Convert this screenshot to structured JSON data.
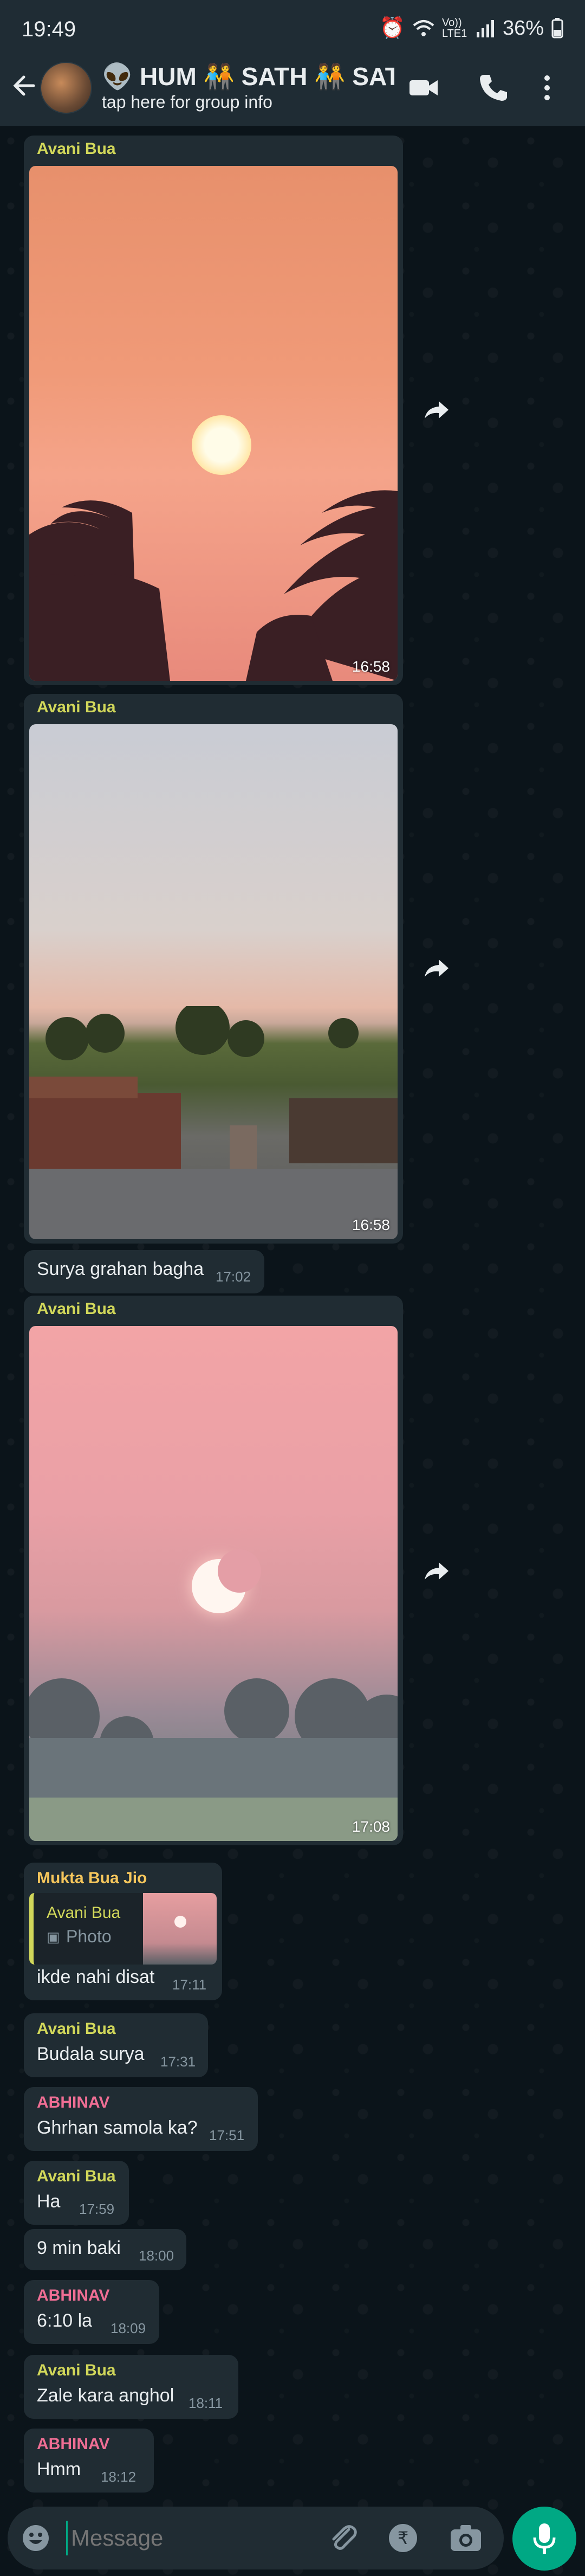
{
  "status_bar": {
    "time": "19:49",
    "battery": "36%",
    "network": "Vo)) LTE1"
  },
  "header": {
    "title": "👽 HUM 🧑‍🤝‍🧑 SATH 🧑‍🤝‍🧑 SAT...",
    "subtitle": "tap here for group info"
  },
  "messages": [
    {
      "sender": "Avani Bua",
      "sender_color": "#d1d75a",
      "type": "photo",
      "time": "16:58"
    },
    {
      "sender": "Avani Bua",
      "sender_color": "#d1d75a",
      "type": "photo",
      "time": "16:58"
    },
    {
      "type": "text",
      "text": "Surya grahan bagha",
      "time": "17:02"
    },
    {
      "sender": "Avani Bua",
      "sender_color": "#d1d75a",
      "type": "photo",
      "time": "17:08"
    },
    {
      "sender": "Mukta Bua Jio",
      "sender_color": "#f5c65c",
      "type": "reply",
      "quote_sender": "Avani Bua",
      "quote_text": "Photo",
      "text": "ikde nahi disat",
      "time": "17:11"
    },
    {
      "sender": "Avani Bua",
      "sender_color": "#d1d75a",
      "type": "text",
      "text": "Budala surya",
      "time": "17:31"
    },
    {
      "sender": "ABHINAV",
      "sender_color": "#ef6e94",
      "type": "text",
      "text": "Ghrhan samola ka?",
      "time": "17:51"
    },
    {
      "sender": "Avani Bua",
      "sender_color": "#d1d75a",
      "type": "text",
      "text": "Ha",
      "time": "17:59"
    },
    {
      "type": "text",
      "text": "9 min baki",
      "time": "18:00"
    },
    {
      "sender": "ABHINAV",
      "sender_color": "#ef6e94",
      "type": "text",
      "text": "6:10 la",
      "time": "18:09"
    },
    {
      "sender": "Avani Bua",
      "sender_color": "#d1d75a",
      "type": "text",
      "text": "Zale kara anghol",
      "time": "18:11"
    },
    {
      "sender": "ABHINAV",
      "sender_color": "#ef6e94",
      "type": "text",
      "text": "Hmm",
      "time": "18:12"
    }
  ],
  "input": {
    "placeholder": "Message"
  },
  "colors": {
    "accent": "#00a884",
    "bubble": "#202c33",
    "header": "#1f2c34",
    "background": "#0b141a"
  }
}
